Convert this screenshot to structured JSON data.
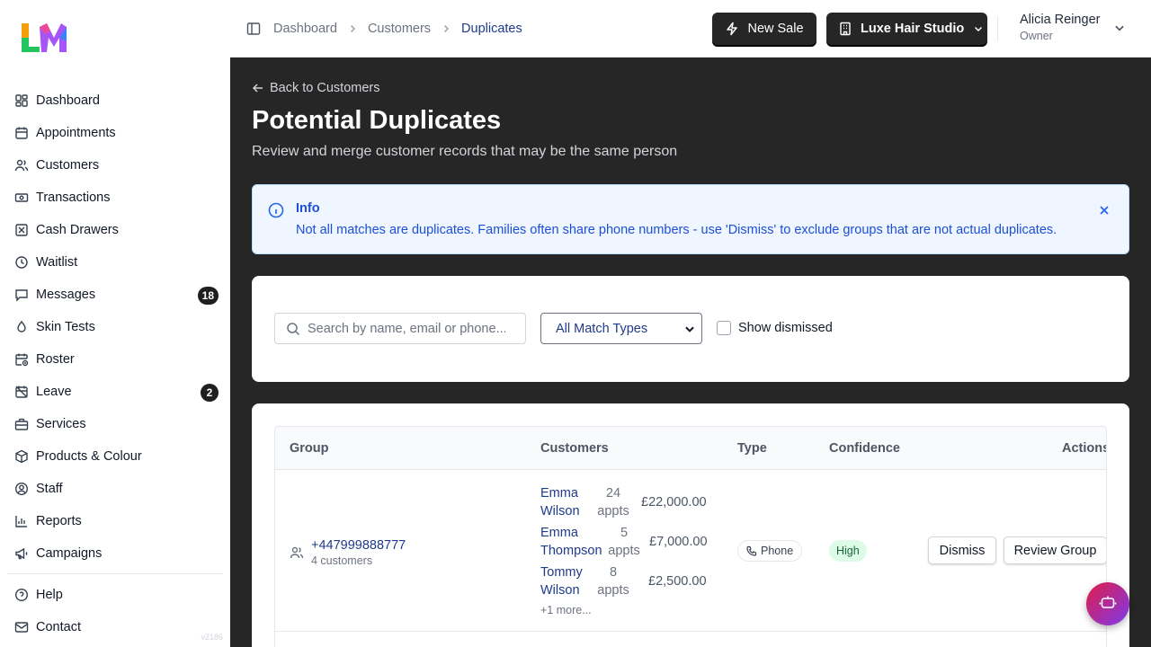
{
  "app": {
    "logo_text": "LM",
    "version": "v2186"
  },
  "sidebar": {
    "items": [
      {
        "label": "Dashboard",
        "icon": "dashboard-icon"
      },
      {
        "label": "Appointments",
        "icon": "calendar-icon"
      },
      {
        "label": "Customers",
        "icon": "users-icon"
      },
      {
        "label": "Transactions",
        "icon": "banknote-icon"
      },
      {
        "label": "Cash Drawers",
        "icon": "cash-drawer-icon"
      },
      {
        "label": "Waitlist",
        "icon": "clock-icon"
      },
      {
        "label": "Messages",
        "icon": "message-icon",
        "badge": "18"
      },
      {
        "label": "Skin Tests",
        "icon": "droplet-icon"
      },
      {
        "label": "Roster",
        "icon": "calendar-clock-icon"
      },
      {
        "label": "Leave",
        "icon": "calendar-off-icon",
        "badge": "2"
      },
      {
        "label": "Services",
        "icon": "briefcase-icon"
      },
      {
        "label": "Products & Colour",
        "icon": "package-icon"
      },
      {
        "label": "Staff",
        "icon": "user-circle-icon"
      },
      {
        "label": "Reports",
        "icon": "bar-chart-icon"
      },
      {
        "label": "Campaigns",
        "icon": "megaphone-icon"
      }
    ],
    "footer_items": [
      {
        "label": "Help",
        "icon": "help-icon"
      },
      {
        "label": "Contact",
        "icon": "mail-icon"
      }
    ]
  },
  "topbar": {
    "breadcrumb": [
      "Dashboard",
      "Customers",
      "Duplicates"
    ],
    "new_sale_label": "New Sale",
    "store_label": "Luxe Hair Studio",
    "user_name": "Alicia Reinger",
    "user_role": "Owner"
  },
  "page": {
    "back_label": "Back to Customers",
    "title": "Potential Duplicates",
    "subtitle": "Review and merge customer records that may be the same person"
  },
  "info": {
    "title": "Info",
    "text": "Not all matches are duplicates. Families often share phone numbers - use 'Dismiss' to exclude groups that are not actual duplicates."
  },
  "filters": {
    "search_placeholder": "Search by name, email or phone...",
    "match_type": "All Match Types",
    "show_dismissed_label": "Show dismissed"
  },
  "table": {
    "headers": {
      "group": "Group",
      "customers": "Customers",
      "type": "Type",
      "confidence": "Confidence",
      "actions": "Actions"
    },
    "rows": [
      {
        "group_title": "+447999888777",
        "group_sub": "4 customers",
        "customers": [
          {
            "first": "Emma",
            "last": "Wilson",
            "appts_num": "24",
            "appts_word": "appts",
            "amount": "£22,000.00"
          },
          {
            "first": "Emma",
            "last": "Thompson",
            "appts_num": "5",
            "appts_word": "appts",
            "amount": "£7,000.00"
          },
          {
            "first": "Tommy",
            "last": "Wilson",
            "appts_num": "8",
            "appts_word": "appts",
            "amount": "£2,500.00"
          }
        ],
        "more": "+1 more...",
        "type": "Phone",
        "confidence": "High",
        "dismiss_label": "Dismiss",
        "review_label": "Review Group"
      }
    ]
  }
}
